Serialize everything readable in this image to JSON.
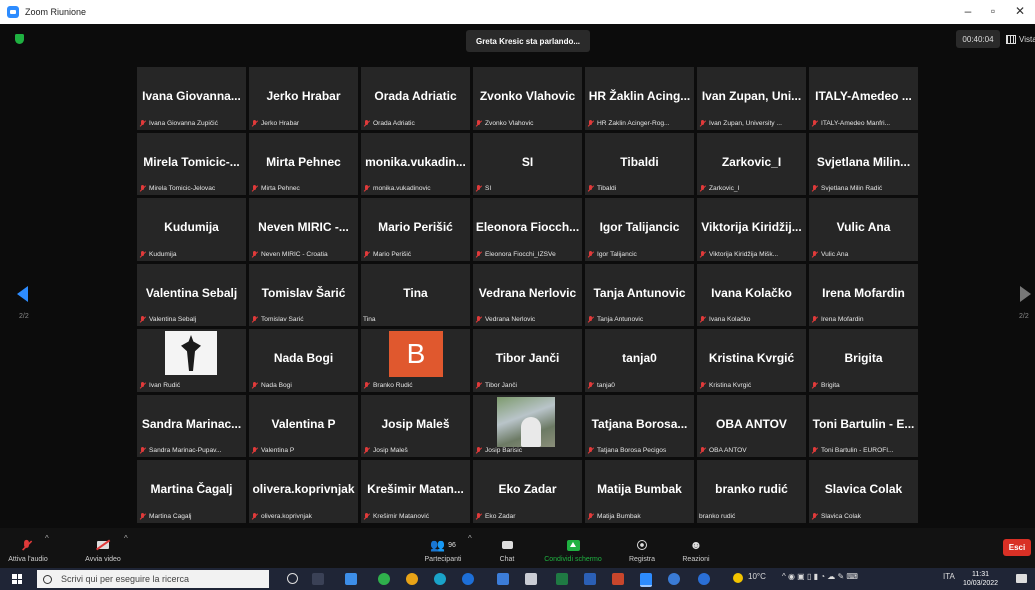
{
  "window": {
    "title": "Zoom Riunione"
  },
  "topbar": {
    "speaking": "Greta Kresic sta parlando...",
    "timer": "00:40:04",
    "view_label": "Vista"
  },
  "pager": {
    "left": "2/2",
    "right": "2/2"
  },
  "participants": [
    {
      "big": "Ivana Giovanna...",
      "small": "Ivana Giovanna Zupičić",
      "muted": true
    },
    {
      "big": "Jerko Hrabar",
      "small": "Jerko Hrabar",
      "muted": true
    },
    {
      "big": "Orada Adriatic",
      "small": "Orada Adriatic",
      "muted": true
    },
    {
      "big": "Zvonko Vlahovic",
      "small": "Zvonko Vlahovic",
      "muted": true
    },
    {
      "big": "HR Žaklin Acing...",
      "small": "HR Žaklin Acinger-Rog...",
      "muted": true
    },
    {
      "big": "Ivan Zupan, Uni...",
      "small": "Ivan Zupan, University ...",
      "muted": true
    },
    {
      "big": "ITALY-Amedeo ...",
      "small": "ITALY-Amedeo Manfri...",
      "muted": true
    },
    {
      "big": "Mirela Tomicic-...",
      "small": "Mirela Tomicic-Jelovac",
      "muted": true
    },
    {
      "big": "Mirta Pehnec",
      "small": "Mirta Pehnec",
      "muted": true
    },
    {
      "big": "monika.vukadin...",
      "small": "monika.vukadinovic",
      "muted": true
    },
    {
      "big": "SI",
      "small": "SI",
      "muted": true
    },
    {
      "big": "Tibaldi",
      "small": "Tibaldi",
      "muted": true
    },
    {
      "big": "Zarkovic_I",
      "small": "Zarkovic_I",
      "muted": true
    },
    {
      "big": "Svjetlana Milin...",
      "small": "Svjetlana Milin Radić",
      "muted": true
    },
    {
      "big": "Kudumija",
      "small": "Kudumija",
      "muted": true
    },
    {
      "big": "Neven MIRIC -...",
      "small": "Neven MIRIC - Croatia",
      "muted": true
    },
    {
      "big": "Mario Perišić",
      "small": "Mario Perišić",
      "muted": true
    },
    {
      "big": "Eleonora Fiocch...",
      "small": "Eleonora Fiocchi_IZSVe",
      "muted": true
    },
    {
      "big": "Igor Talijancic",
      "small": "Igor Talijancic",
      "muted": true
    },
    {
      "big": "Viktorija Kiridžij...",
      "small": "Viktorija Kiridžija Mišk...",
      "muted": true
    },
    {
      "big": "Vulic Ana",
      "small": "Vulic Ana",
      "muted": true
    },
    {
      "big": "Valentina Sebalj",
      "small": "Valentina Sebalj",
      "muted": true
    },
    {
      "big": "Tomislav Šarić",
      "small": "Tomislav Šarić",
      "muted": true
    },
    {
      "big": "Tina",
      "small": "Tina",
      "muted": false
    },
    {
      "big": "Vedrana Nerlovic",
      "small": "Vedrana Nerlovic",
      "muted": true
    },
    {
      "big": "Tanja Antunovic",
      "small": "Tanja Antunovic",
      "muted": true
    },
    {
      "big": "Ivana Kolačko",
      "small": "Ivana Kolačko",
      "muted": true
    },
    {
      "big": "Irena Mofardin",
      "small": "Irena Mofardin",
      "muted": true
    },
    {
      "big": "",
      "small": "Ivan Rudić",
      "muted": true,
      "media": "photo-cross"
    },
    {
      "big": "Nada Bogi",
      "small": "Nada Bogi",
      "muted": true
    },
    {
      "big": "",
      "small": "Branko Rudić",
      "muted": true,
      "media": "avatar-letter",
      "letter": "B"
    },
    {
      "big": "Tibor Janči",
      "small": "Tibor Janči",
      "muted": true
    },
    {
      "big": "tanja0",
      "small": "tanja0",
      "muted": true
    },
    {
      "big": "Kristina Kvrgić",
      "small": "Kristina Kvrgić",
      "muted": true
    },
    {
      "big": "Brigita",
      "small": "Brigita",
      "muted": true
    },
    {
      "big": "Sandra Marinac...",
      "small": "Sandra Marinac-Pupav...",
      "muted": true
    },
    {
      "big": "Valentina P",
      "small": "Valentina P",
      "muted": true
    },
    {
      "big": "Josip Maleš",
      "small": "Josip Maleš",
      "muted": true
    },
    {
      "big": "",
      "small": "Josip Barisic",
      "muted": true,
      "media": "photo-person"
    },
    {
      "big": "Tatjana Borosa...",
      "small": "Tatjana Borosa Pecigos",
      "muted": true
    },
    {
      "big": "OBA ANTOV",
      "small": "OBA ANTOV",
      "muted": true
    },
    {
      "big": "Toni Bartulin - E...",
      "small": "Toni Bartulin - EUROFI...",
      "muted": true
    },
    {
      "big": "Martina Čagalj",
      "small": "Martina Čagalj",
      "muted": true
    },
    {
      "big": "olivera.koprivnjak",
      "small": "olivera.koprivnjak",
      "muted": true
    },
    {
      "big": "Krešimir Matan...",
      "small": "Krešimir Matanović",
      "muted": true
    },
    {
      "big": "Eko Zadar",
      "small": "Eko Zadar",
      "muted": true
    },
    {
      "big": "Matija Bumbak",
      "small": "Matija Bumbak",
      "muted": true
    },
    {
      "big": "branko rudić",
      "small": "branko rudić",
      "muted": false
    },
    {
      "big": "Slavica Colak",
      "small": "Slavica Colak",
      "muted": true
    }
  ],
  "toolbar": {
    "audio": "Attiva l'audio",
    "video": "Avvia video",
    "participants": "Partecipanti",
    "participants_count": "96",
    "chat": "Chat",
    "share": "Condividi schermo",
    "record": "Registra",
    "reactions": "Reazioni",
    "leave": "Esci"
  },
  "taskbar": {
    "search_placeholder": "Scrivi qui per eseguire la ricerca",
    "weather": "10°C",
    "lang": "ITA",
    "time": "11:31",
    "date": "10/03/2022"
  },
  "colors": {
    "accent": "#2d8cff",
    "mute_red": "#e03a3a",
    "leave_red": "#d93025",
    "share_green": "#1fb141"
  }
}
